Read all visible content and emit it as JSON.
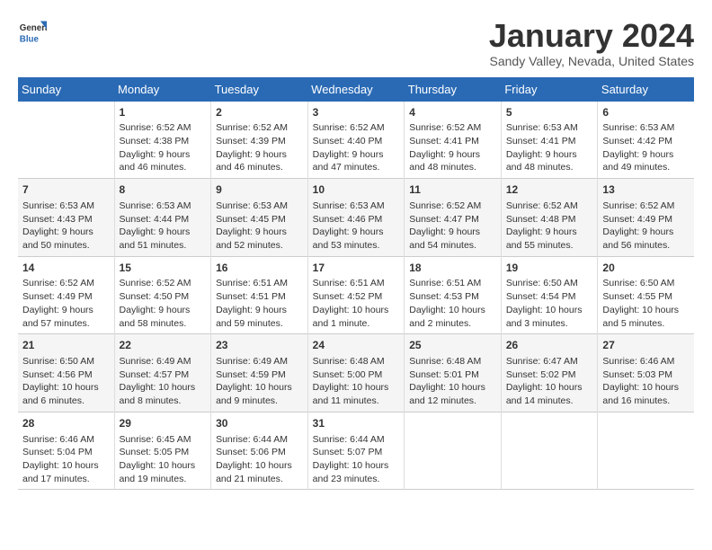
{
  "header": {
    "logo_line1": "General",
    "logo_line2": "Blue",
    "month": "January 2024",
    "location": "Sandy Valley, Nevada, United States"
  },
  "weekdays": [
    "Sunday",
    "Monday",
    "Tuesday",
    "Wednesday",
    "Thursday",
    "Friday",
    "Saturday"
  ],
  "weeks": [
    [
      {
        "day": "",
        "data": ""
      },
      {
        "day": "1",
        "data": "Sunrise: 6:52 AM\nSunset: 4:38 PM\nDaylight: 9 hours\nand 46 minutes."
      },
      {
        "day": "2",
        "data": "Sunrise: 6:52 AM\nSunset: 4:39 PM\nDaylight: 9 hours\nand 46 minutes."
      },
      {
        "day": "3",
        "data": "Sunrise: 6:52 AM\nSunset: 4:40 PM\nDaylight: 9 hours\nand 47 minutes."
      },
      {
        "day": "4",
        "data": "Sunrise: 6:52 AM\nSunset: 4:41 PM\nDaylight: 9 hours\nand 48 minutes."
      },
      {
        "day": "5",
        "data": "Sunrise: 6:53 AM\nSunset: 4:41 PM\nDaylight: 9 hours\nand 48 minutes."
      },
      {
        "day": "6",
        "data": "Sunrise: 6:53 AM\nSunset: 4:42 PM\nDaylight: 9 hours\nand 49 minutes."
      }
    ],
    [
      {
        "day": "7",
        "data": "Sunrise: 6:53 AM\nSunset: 4:43 PM\nDaylight: 9 hours\nand 50 minutes."
      },
      {
        "day": "8",
        "data": "Sunrise: 6:53 AM\nSunset: 4:44 PM\nDaylight: 9 hours\nand 51 minutes."
      },
      {
        "day": "9",
        "data": "Sunrise: 6:53 AM\nSunset: 4:45 PM\nDaylight: 9 hours\nand 52 minutes."
      },
      {
        "day": "10",
        "data": "Sunrise: 6:53 AM\nSunset: 4:46 PM\nDaylight: 9 hours\nand 53 minutes."
      },
      {
        "day": "11",
        "data": "Sunrise: 6:52 AM\nSunset: 4:47 PM\nDaylight: 9 hours\nand 54 minutes."
      },
      {
        "day": "12",
        "data": "Sunrise: 6:52 AM\nSunset: 4:48 PM\nDaylight: 9 hours\nand 55 minutes."
      },
      {
        "day": "13",
        "data": "Sunrise: 6:52 AM\nSunset: 4:49 PM\nDaylight: 9 hours\nand 56 minutes."
      }
    ],
    [
      {
        "day": "14",
        "data": "Sunrise: 6:52 AM\nSunset: 4:49 PM\nDaylight: 9 hours\nand 57 minutes."
      },
      {
        "day": "15",
        "data": "Sunrise: 6:52 AM\nSunset: 4:50 PM\nDaylight: 9 hours\nand 58 minutes."
      },
      {
        "day": "16",
        "data": "Sunrise: 6:51 AM\nSunset: 4:51 PM\nDaylight: 9 hours\nand 59 minutes."
      },
      {
        "day": "17",
        "data": "Sunrise: 6:51 AM\nSunset: 4:52 PM\nDaylight: 10 hours\nand 1 minute."
      },
      {
        "day": "18",
        "data": "Sunrise: 6:51 AM\nSunset: 4:53 PM\nDaylight: 10 hours\nand 2 minutes."
      },
      {
        "day": "19",
        "data": "Sunrise: 6:50 AM\nSunset: 4:54 PM\nDaylight: 10 hours\nand 3 minutes."
      },
      {
        "day": "20",
        "data": "Sunrise: 6:50 AM\nSunset: 4:55 PM\nDaylight: 10 hours\nand 5 minutes."
      }
    ],
    [
      {
        "day": "21",
        "data": "Sunrise: 6:50 AM\nSunset: 4:56 PM\nDaylight: 10 hours\nand 6 minutes."
      },
      {
        "day": "22",
        "data": "Sunrise: 6:49 AM\nSunset: 4:57 PM\nDaylight: 10 hours\nand 8 minutes."
      },
      {
        "day": "23",
        "data": "Sunrise: 6:49 AM\nSunset: 4:59 PM\nDaylight: 10 hours\nand 9 minutes."
      },
      {
        "day": "24",
        "data": "Sunrise: 6:48 AM\nSunset: 5:00 PM\nDaylight: 10 hours\nand 11 minutes."
      },
      {
        "day": "25",
        "data": "Sunrise: 6:48 AM\nSunset: 5:01 PM\nDaylight: 10 hours\nand 12 minutes."
      },
      {
        "day": "26",
        "data": "Sunrise: 6:47 AM\nSunset: 5:02 PM\nDaylight: 10 hours\nand 14 minutes."
      },
      {
        "day": "27",
        "data": "Sunrise: 6:46 AM\nSunset: 5:03 PM\nDaylight: 10 hours\nand 16 minutes."
      }
    ],
    [
      {
        "day": "28",
        "data": "Sunrise: 6:46 AM\nSunset: 5:04 PM\nDaylight: 10 hours\nand 17 minutes."
      },
      {
        "day": "29",
        "data": "Sunrise: 6:45 AM\nSunset: 5:05 PM\nDaylight: 10 hours\nand 19 minutes."
      },
      {
        "day": "30",
        "data": "Sunrise: 6:44 AM\nSunset: 5:06 PM\nDaylight: 10 hours\nand 21 minutes."
      },
      {
        "day": "31",
        "data": "Sunrise: 6:44 AM\nSunset: 5:07 PM\nDaylight: 10 hours\nand 23 minutes."
      },
      {
        "day": "",
        "data": ""
      },
      {
        "day": "",
        "data": ""
      },
      {
        "day": "",
        "data": ""
      }
    ]
  ]
}
